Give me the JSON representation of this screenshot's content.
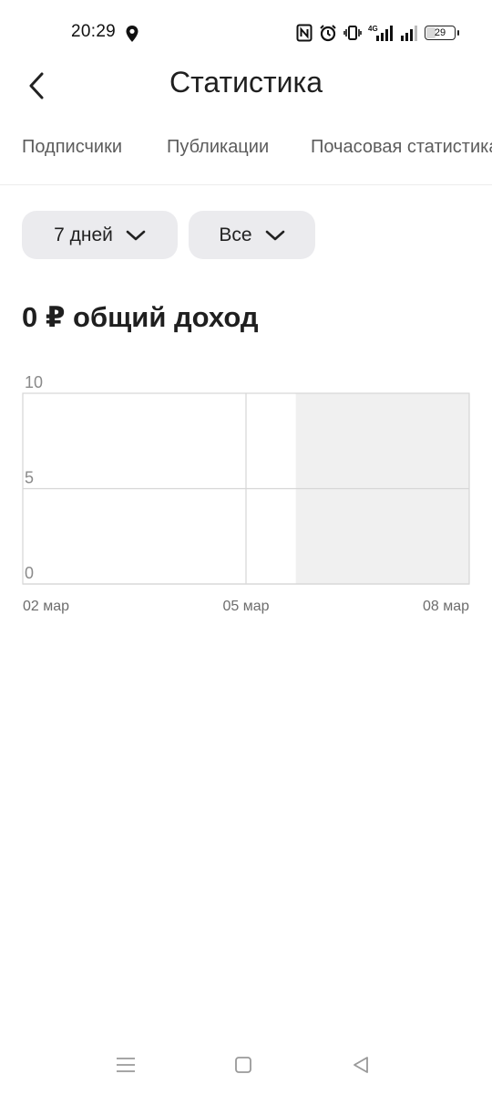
{
  "status_bar": {
    "time": "20:29",
    "battery": "29",
    "network": "4G"
  },
  "header": {
    "title": "Статистика"
  },
  "tabs": [
    {
      "label": "Подписчики"
    },
    {
      "label": "Публикации"
    },
    {
      "label": "Почасовая статистика"
    }
  ],
  "filters": {
    "period": "7 дней",
    "type": "Все"
  },
  "income": {
    "heading": "0 ₽ общий доход"
  },
  "chart_data": {
    "type": "area",
    "title": "",
    "xlabel": "",
    "ylabel": "",
    "y_ticks": [
      "10",
      "5",
      "0"
    ],
    "x_ticks": [
      "02 мар",
      "05 мар",
      "08 мар"
    ],
    "ylim": [
      0,
      10
    ],
    "x": [
      "02 мар",
      "03 мар",
      "04 мар",
      "05 мар",
      "06 мар",
      "07 мар",
      "08 мар"
    ],
    "series": [
      {
        "values": [
          0,
          0,
          0,
          0,
          0,
          0,
          0
        ]
      }
    ],
    "grid": true,
    "shaded_range": [
      "06 мар",
      "08 мар"
    ],
    "colors": {
      "grid": "#d6d6d6",
      "shade": "#f0f0f0",
      "tick_text": "#8a8a8a"
    }
  }
}
